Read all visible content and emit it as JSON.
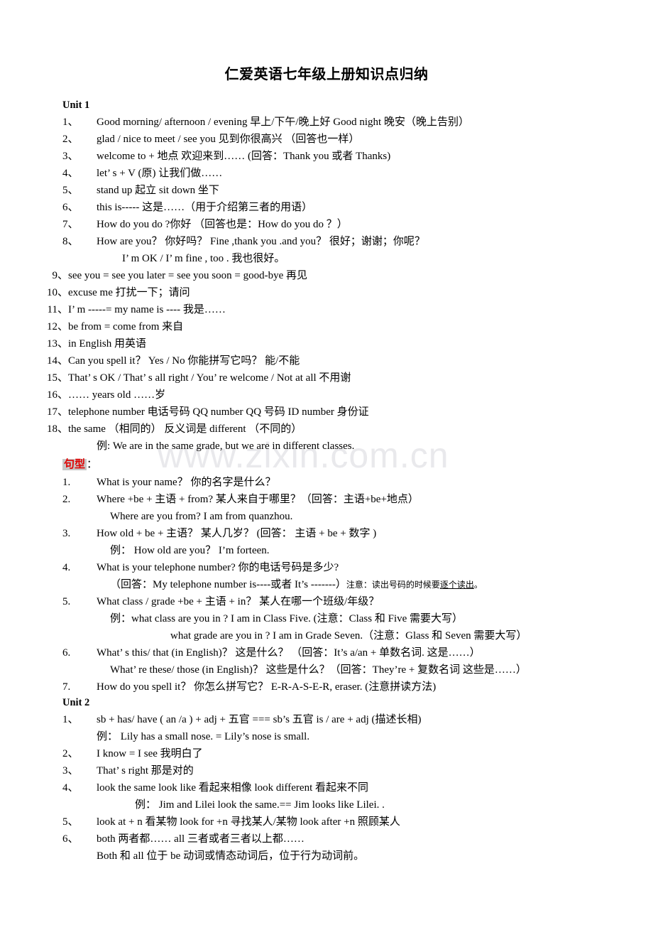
{
  "document": {
    "title": "仁爱英语七年级上册知识点归纳",
    "watermark": "www.zixin.com.cn"
  },
  "unit1": {
    "heading": "Unit 1",
    "items": [
      {
        "num": "1、",
        "text": "Good morning/ afternoon / evening    早上/下午/晚上好        Good night    晚安（晚上告别）"
      },
      {
        "num": "2、",
        "text": "glad / nice to meet / see you   见到你很高兴 （回答也一样）"
      },
      {
        "num": "3、",
        "text": "welcome to +  地点    欢迎来到……    (回答：Thank   you  或者 Thanks)"
      },
      {
        "num": "4、",
        "text": "let’ s +   V (原)     让我们做……"
      },
      {
        "num": "5、",
        "text": "stand up  起立             sit down  坐下"
      },
      {
        "num": "6、",
        "text": "this is-----    这是……（用于介绍第三者的用语）"
      },
      {
        "num": "7、",
        "text": "How do you do ?你好        （回答也是：How do you do ？）"
      },
      {
        "num": "8、",
        "text": "How are you？   你好吗？        Fine ,thank you .and you？    很好；谢谢；你呢？"
      },
      {
        "num": "",
        "cont": "I’ m OK / I’ m fine , too .   我也很好。",
        "indent": "i1"
      },
      {
        "num": "9、",
        "text": "see you = see you later = see you soon = good-bye        再见"
      },
      {
        "num": "10、",
        "text": "excuse me          打扰一下；请问"
      },
      {
        "num": "11、",
        "text": " I’ m -----= my name is ----    我是……"
      },
      {
        "num": "12、",
        "text": "be   from   =   come   from      来自"
      },
      {
        "num": "13、",
        "text": " in   English  用英语"
      },
      {
        "num": "14、",
        "text": "Can you spell it？  Yes / No   你能拼写它吗？    能/不能"
      },
      {
        "num": "15、",
        "text": "That’ s OK / That’ s all right / You’ re welcome / Not   at   all    不用谢"
      },
      {
        "num": "16、",
        "text": "……  years old                ……岁"
      },
      {
        "num": "17、",
        "text": "telephone number     电话号码        QQ number   QQ 号码    ID number   身份证"
      },
      {
        "num": "18、",
        "text": "the   same    （相同的）    反义词是    different    （不同的）"
      },
      {
        "num": "",
        "cont": "例: We are in the same grade, but we are in different classes.",
        "indent": "i3"
      }
    ]
  },
  "sentence_patterns": {
    "label": "句型",
    "colon": "：",
    "items": [
      {
        "num": "1.",
        "text": "What   is   your   name？     你的名字是什么？"
      },
      {
        "num": "2.",
        "text": "Where   +be +  主语   +   from?      某人来自于哪里？（回答：主语+be+地点）"
      },
      {
        "num": "",
        "cont": "Where   are   you   from?      I   am   from   quanzhou.",
        "indent": "i4"
      },
      {
        "num": "3.",
        "text": "How old + be +  主语？   某人几岁？   (回答：  主语 + be +  数字 )"
      },
      {
        "num": "",
        "cont": "例：  How old   are   you？        I’m   forteen.",
        "indent": "i4"
      },
      {
        "num": "4.",
        "text": "What is your telephone   number?    你的电话号码是多少?"
      },
      {
        "num": "",
        "cont_pre": "（回答：My telephone number is----或者 It’s -------）",
        "cont_small": "注意：读出号码的时候要",
        "cont_u": "逐个读出",
        "cont_post": "。",
        "indent": "i4"
      },
      {
        "num": "5.",
        "text": "What    class / grade    +be +  主语   +  in？   某人在哪一个班级/年级？"
      },
      {
        "num": "",
        "cont": "例：what    class    are  you    in  ?   I   am  in  Class  Five.  (注意：Class 和 Five 需要大写）",
        "indent": "i4"
      },
      {
        "num": "",
        "cont": "what    grade    are  you   in ?  I am  in  Grade  Seven.（注意：Glass 和 Seven 需要大写）",
        "indent": "i5"
      },
      {
        "num": "6.",
        "text": "What’ s this/ that   (in   English)？  这是什么？   （回答：It’s   a/an   + 单数名词.    这是……）"
      },
      {
        "num": "",
        "cont": "What’ re   these/ those (in   English)？  这些是什么？（回答：They’re +  复数名词    这些是……）",
        "indent": "i4"
      },
      {
        "num": "7.",
        "text": "How do you spell it？   你怎么拼写它？            E-R-A-S-E-R, eraser.     (注意拼读方法)"
      }
    ]
  },
  "unit2": {
    "heading": "Unit 2",
    "items": [
      {
        "num": "1、",
        "text": "sb + has/ have ( an /a ) + adj +  五官   === sb’s    五官  is / are   +   adj   (描述长相)"
      },
      {
        "num": "",
        "cont": "例： Lily   has   a   small nose.  = Lily’s nose   is   small.",
        "indent": "i3"
      },
      {
        "num": "2、",
        "text": "I know = I see    我明白了"
      },
      {
        "num": "3、",
        "text": "That’ s right      那是对的"
      },
      {
        "num": "4、",
        "text": "look the same      look   like   看起来相像       look different      看起来不同"
      },
      {
        "num": "",
        "cont": "例：  Jim   and   Lilei look the same.== Jim   looks like   Lilei.   .",
        "indent": "i2"
      },
      {
        "num": "5、",
        "text": "look at + n     看某物    look for +n  寻找某人/某物  look after +n  照顾某人"
      },
      {
        "num": "6、",
        "text": "both    两者都……    all  三者或者三者以上都……"
      },
      {
        "num": "",
        "cont": "Both 和 all 位于 be 动词或情态动词后，位于行为动词前。",
        "indent": "i3"
      }
    ]
  }
}
